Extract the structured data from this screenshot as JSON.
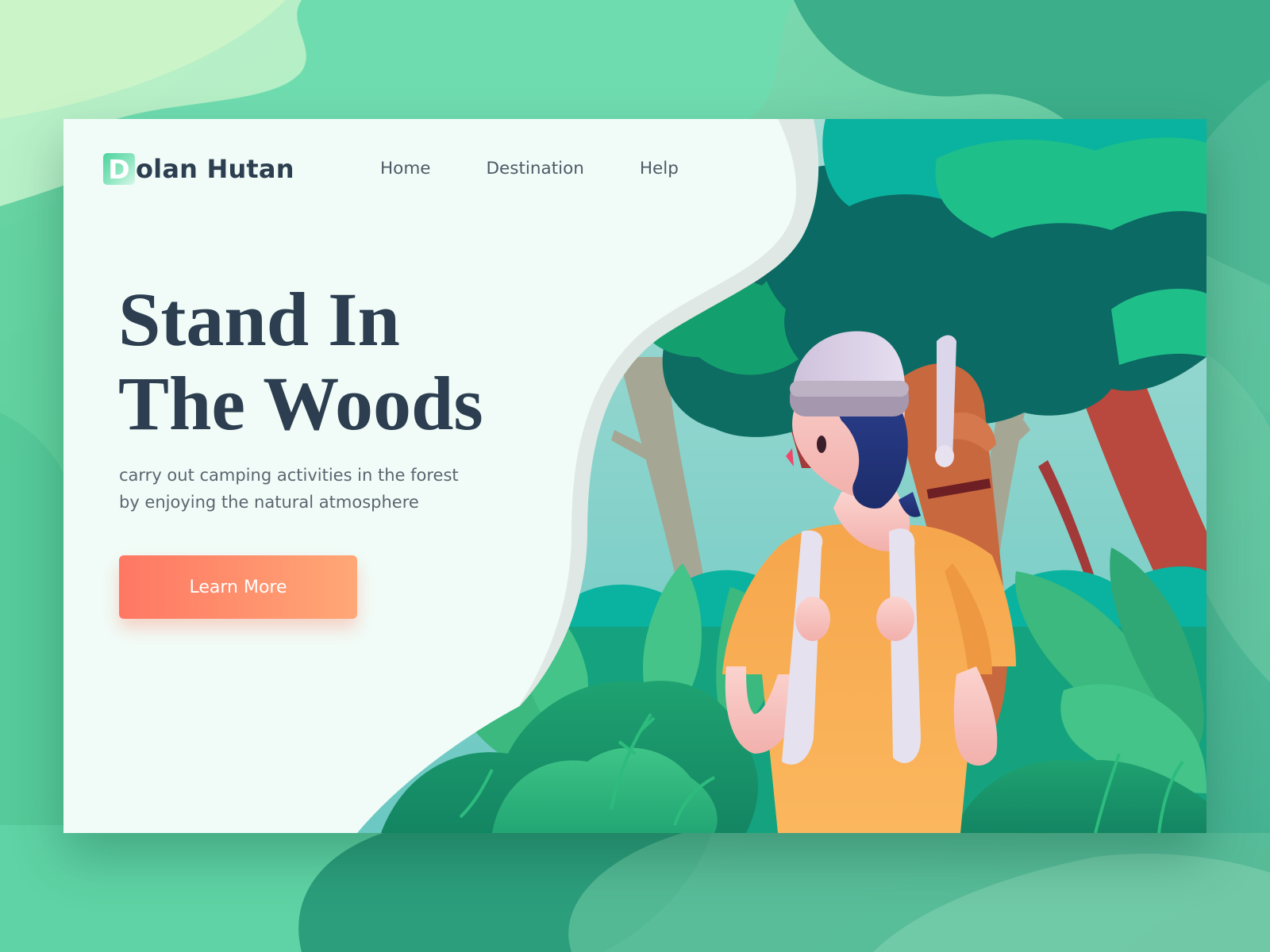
{
  "brand": {
    "initial": "D",
    "rest": "olan Hutan"
  },
  "nav": {
    "items": [
      {
        "label": "Home"
      },
      {
        "label": "Destination"
      },
      {
        "label": "Help"
      }
    ]
  },
  "hero": {
    "title_lines": [
      "Stand In",
      "The Woods"
    ],
    "subtitle_lines": [
      "carry out camping activities in the forest",
      "by enjoying the natural atmosphere"
    ],
    "cta_label": "Learn More"
  },
  "theme": {
    "heading_color": "#2c3e50",
    "cta_gradient": [
      "#ff7763",
      "#ffa876"
    ],
    "brand_accent": "#4bd39d",
    "card_background": "#f1fcf8"
  }
}
